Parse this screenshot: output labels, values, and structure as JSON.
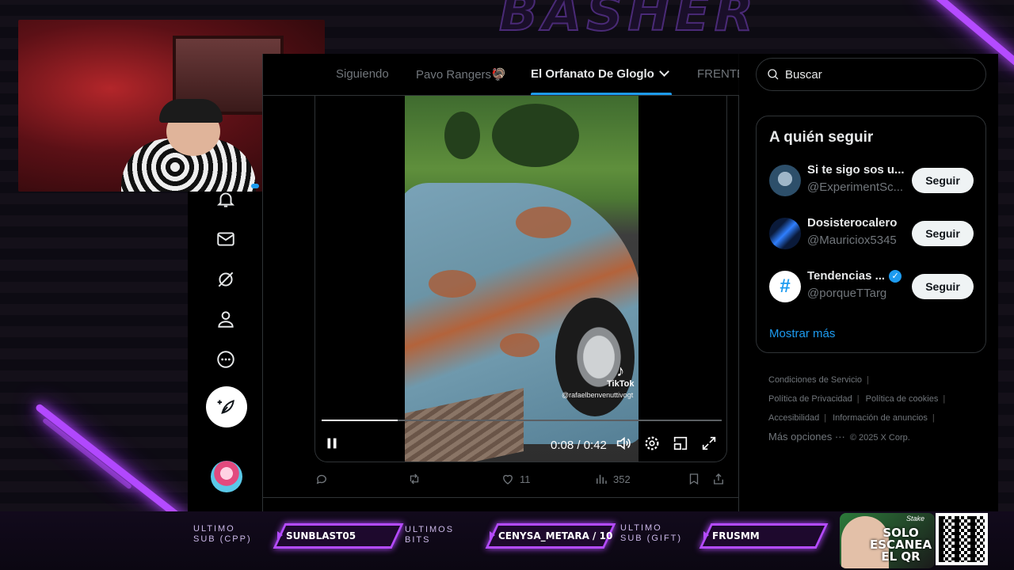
{
  "overlay": {
    "brand_text": "BASHER"
  },
  "tabs": [
    {
      "label": "Siguiendo",
      "active": false
    },
    {
      "label": "Pavo Rangers🦃",
      "active": false
    },
    {
      "label": "El Orfanato De Gloglo",
      "active": true
    },
    {
      "label": "FRENTE",
      "active": false
    }
  ],
  "video": {
    "time": "0:08 / 0:42",
    "progress": 0.19,
    "watermark_brand": "TikTok",
    "watermark_handle": "@rafaelbenvenuttivogt"
  },
  "post_actions": {
    "likes": "11",
    "views": "352"
  },
  "search": {
    "placeholder": "Buscar"
  },
  "who_to_follow": {
    "title": "A quién seguir",
    "accounts": [
      {
        "name": "Si te sigo sos u...",
        "handle": "@ExperimentSc...",
        "verified": false,
        "button": "Seguir"
      },
      {
        "name": "Dosisterocalero",
        "handle": "@Mauriciox5345",
        "verified": false,
        "button": "Seguir"
      },
      {
        "name": "Tendencias ...",
        "handle": "@porqueTTarg",
        "verified": true,
        "button": "Seguir"
      }
    ],
    "show_more": "Mostrar más"
  },
  "footer": {
    "links": [
      "Condiciones de Servicio",
      "Política de Privacidad",
      "Política de cookies",
      "Accesibilidad",
      "Información de anuncios",
      "Más opciones ···"
    ],
    "copyright": "© 2025 X Corp."
  },
  "stream_bar": {
    "last_sub_label_1": "ULTIMO",
    "last_sub_label_2": "SUB (CPP)",
    "last_sub_value": "SUNBLAST05",
    "last_bits_label_1": "ULTIMOS",
    "last_bits_label_2": "BITS",
    "last_bits_value": "CENYSA_METARA / 10",
    "last_gift_label_1": "ULTIMO",
    "last_gift_label_2": "SUB (GIFT)",
    "last_gift_value": "FRUSMM",
    "promo_text_1": "SOLO",
    "promo_text_2": "ESCANEA",
    "promo_text_3": "EL QR",
    "promo_tag": "Stake"
  },
  "colors": {
    "accent": "#1d9bf0",
    "neon": "#b44bff",
    "background": "#000000"
  }
}
